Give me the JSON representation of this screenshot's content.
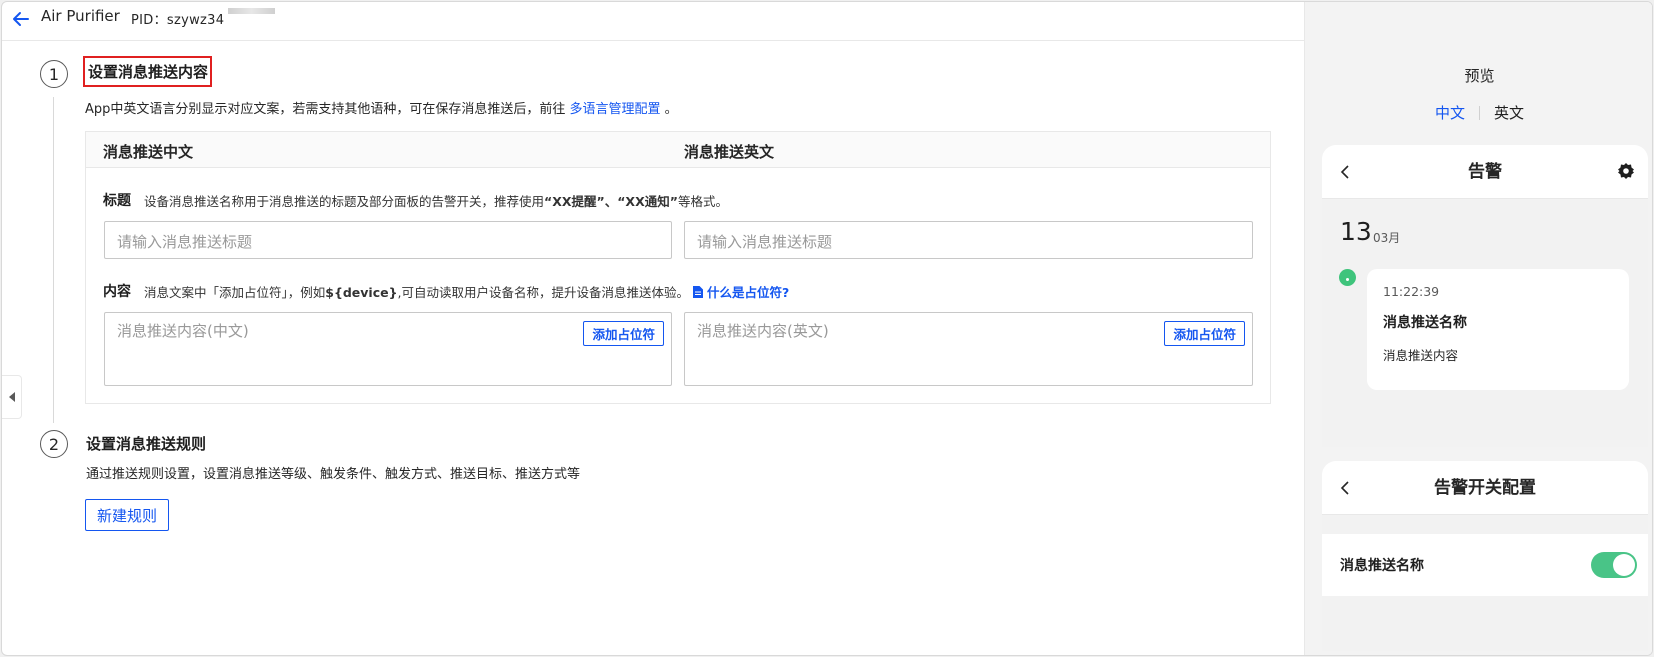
{
  "header": {
    "title": "Air Purifier",
    "pid": "PID：szywz34"
  },
  "step1": {
    "number": "1",
    "title": "设置消息推送内容",
    "desc_prefix": "App中英文语言分别显示对应文案，若需支持其他语种，可在保存消息推送后，前往 ",
    "desc_link": "多语言管理配置",
    "desc_suffix": " 。",
    "columns": {
      "zh": "消息推送中文",
      "en": "消息推送英文"
    },
    "title_field": {
      "label": "标题",
      "hint_prefix": "设备消息推送名称用于消息推送的标题及部分面板的告警开关，推荐使用",
      "hint_bold": "“XX提醒”、“XX通知”",
      "hint_suffix": "等格式。",
      "placeholder_zh": "请输入消息推送标题",
      "placeholder_en": "请输入消息推送标题"
    },
    "content_field": {
      "label": "内容",
      "hint_prefix": "消息文案中「添加占位符」，例如",
      "hint_bold": "${device}",
      "hint_suffix": ",可自动读取用户设备名称，提升设备消息推送体验。",
      "help_link": "什么是占位符?",
      "placeholder_zh": "消息推送内容(中文)",
      "placeholder_en": "消息推送内容(英文)",
      "add_placeholder_label": "添加占位符"
    }
  },
  "step2": {
    "number": "2",
    "title": "设置消息推送规则",
    "desc": "通过推送规则设置，设置消息推送等级、触发条件、触发方式、推送目标、推送方式等",
    "new_rule_label": "新建规则"
  },
  "preview": {
    "title": "预览",
    "tabs": [
      "中文",
      "英文"
    ],
    "active_tab": "中文",
    "alarm_screen": {
      "title": "告警",
      "day": "13",
      "month": "03月",
      "time": "11:22:39",
      "msg_title": "消息推送名称",
      "msg_body": "消息推送内容"
    },
    "switch_screen": {
      "title": "告警开关配置",
      "item_label": "消息推送名称",
      "toggle_on": true
    }
  },
  "colors": {
    "accent": "#1456f0",
    "highlight_border": "#e02020",
    "toggle_on": "#49c487"
  }
}
